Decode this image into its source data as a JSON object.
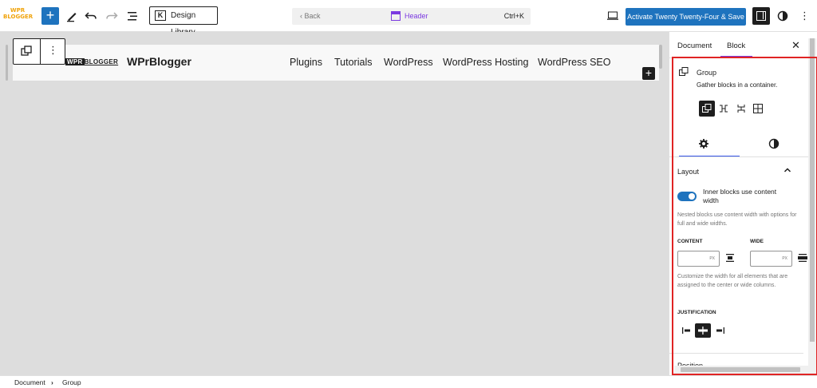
{
  "topbar": {
    "logo_line1": "WPR",
    "logo_line2": "BLOGGER",
    "add_label": "+",
    "design_library_label": "Design Library",
    "command": {
      "back": "‹  Back",
      "title": "Header",
      "shortcut": "Ctrl+K"
    },
    "activate_label": "Activate Twenty Twenty-Four & Save",
    "more_label": "⋮"
  },
  "canvas": {
    "site_logo_a": "WPR",
    "site_logo_b": "BLOGGER",
    "site_title": "WPrBlogger",
    "nav": [
      "Plugins",
      "Tutorials",
      "WordPress",
      "WordPress Hosting",
      "WordPress SEO"
    ],
    "block_more": "⋮",
    "inserter": "+"
  },
  "sidebar": {
    "tabs": {
      "document": "Document",
      "block": "Block"
    },
    "close": "✕",
    "block_card": {
      "title": "Group",
      "description": "Gather blocks in a container."
    },
    "layout": {
      "title": "Layout",
      "toggle_label": "Inner blocks use content width",
      "toggle_on": true,
      "help1": "Nested blocks use content width with options for full and wide widths.",
      "content_label": "CONTENT",
      "wide_label": "WIDE",
      "unit": "PX",
      "help2": "Customize the width for all elements that are assigned to the center or wide columns.",
      "justification_label": "JUSTIFICATION"
    },
    "position_label": "Position"
  },
  "footer": {
    "breadcrumb": [
      "Document",
      "Group"
    ],
    "sep": "›"
  },
  "colors": {
    "accent": "#1e73be",
    "purple": "#7b39e0",
    "highlight": "#e02424"
  }
}
